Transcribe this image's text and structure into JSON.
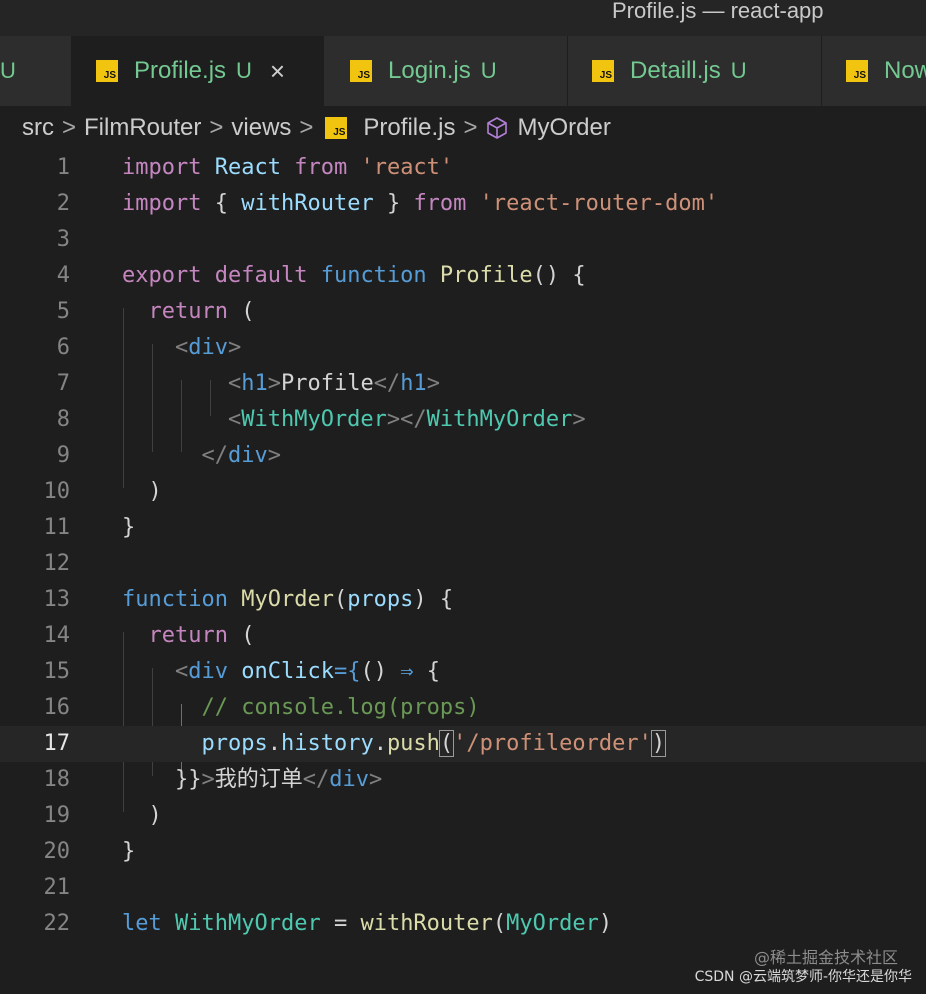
{
  "window": {
    "title": "Profile.js — react-app"
  },
  "tabs": [
    {
      "name": "",
      "status": "U"
    },
    {
      "name": "Profile.js",
      "status": "U",
      "close": "×"
    },
    {
      "name": "Login.js",
      "status": "U"
    },
    {
      "name": "Detaill.js",
      "status": "U"
    },
    {
      "name": "Now",
      "status": ""
    }
  ],
  "breadcrumb": {
    "src": "src",
    "folder": "FilmRouter",
    "views": "views",
    "file": "Profile.js",
    "symbol": "MyOrder",
    "sep": ">"
  },
  "editor": {
    "current_line": 17,
    "lines": [
      "1",
      "2",
      "3",
      "4",
      "5",
      "6",
      "7",
      "8",
      "9",
      "10",
      "11",
      "12",
      "13",
      "14",
      "15",
      "16",
      "17",
      "18",
      "19",
      "20",
      "21",
      "22"
    ],
    "tokens": {
      "import": "import",
      "from": "from",
      "React": "React",
      "react_str": "'react'",
      "brace_open": "{",
      "brace_close": "}",
      "withRouter": "withRouter",
      "rrd_str": "'react-router-dom'",
      "export": "export",
      "default": "default",
      "function": "function",
      "Profile": "Profile",
      "parens": "()",
      "ret": "return",
      "paren_open": "(",
      "paren_close": ")",
      "lt": "<",
      "gt": ">",
      "lts": "</",
      "div": "div",
      "h1": "h1",
      "profile_text": "Profile",
      "WithMyOrder": "WithMyOrder",
      "MyOrder": "MyOrder",
      "props": "props",
      "onClick": "onClick",
      "eq_brace": "={",
      "arrow": "⇒",
      "comment": "// console.log(props)",
      "history": "history",
      "push": "push",
      "dot": ".",
      "order_str": "'/profileorder'",
      "close_jsx": "}}",
      "order_text": "我的订单",
      "let": "let",
      "eq": "="
    }
  },
  "watermark": {
    "line1": "@稀土掘金技术社区",
    "line2": "CSDN @云端筑梦师-你华还是你华"
  },
  "colors": {
    "background": "#1e1e1e",
    "keyword": "#c586c0",
    "storage": "#569cd6",
    "function": "#dcdcaa",
    "variable": "#9cdcfe",
    "string": "#ce9178",
    "comment": "#6a9955",
    "component": "#4ec9b0",
    "untracked": "#73c991",
    "js_icon": "#f1c40f"
  },
  "icons": {
    "file_icon": "js-file-icon",
    "symbol_icon": "cube-icon",
    "close_icon": "close-icon"
  }
}
